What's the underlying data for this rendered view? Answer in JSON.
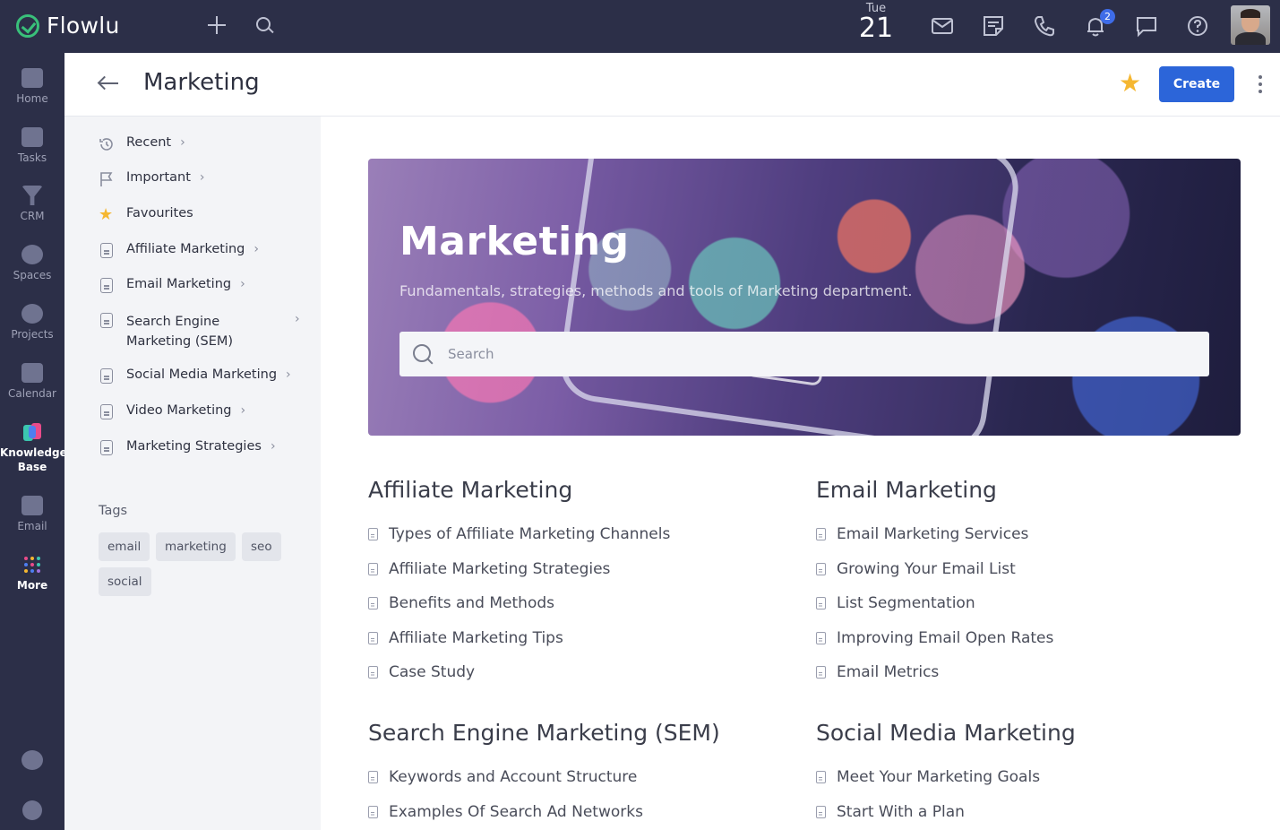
{
  "app": {
    "name": "Flowlu"
  },
  "topbar": {
    "date_dow": "Tue",
    "date_day": "21",
    "notification_count": "2",
    "icons": [
      "plus-icon",
      "search-icon",
      "mail-icon",
      "notes-icon",
      "phone-icon",
      "bell-icon",
      "chat-icon",
      "help-icon"
    ]
  },
  "rail": {
    "items": [
      {
        "label": "Home",
        "icon": "home-icon"
      },
      {
        "label": "Tasks",
        "icon": "tasks-icon"
      },
      {
        "label": "CRM",
        "icon": "crm-icon"
      },
      {
        "label": "Spaces",
        "icon": "spaces-icon"
      },
      {
        "label": "Projects",
        "icon": "projects-icon"
      },
      {
        "label": "Calendar",
        "icon": "calendar-icon"
      },
      {
        "label": "Knowledge Base",
        "icon": "knowledge-base-icon",
        "active": true
      },
      {
        "label": "Email",
        "icon": "email-icon"
      },
      {
        "label": "More",
        "icon": "more-icon"
      }
    ]
  },
  "header": {
    "title": "Marketing",
    "create_label": "Create"
  },
  "sidebar": {
    "items": [
      {
        "label": "Recent",
        "icon": "history-icon",
        "chevron": true
      },
      {
        "label": "Important",
        "icon": "flag-icon",
        "chevron": true
      },
      {
        "label": "Favourites",
        "icon": "star-icon",
        "chevron": false
      },
      {
        "label": "Affiliate Marketing",
        "icon": "document-icon",
        "chevron": true
      },
      {
        "label": "Email Marketing",
        "icon": "document-icon",
        "chevron": true
      },
      {
        "label": "Search Engine Marketing (SEM)",
        "label_line1": "Search Engine",
        "label_line2": "Marketing (SEM)",
        "icon": "document-icon",
        "chevron": true
      },
      {
        "label": "Social Media Marketing",
        "icon": "document-icon",
        "chevron": true
      },
      {
        "label": "Video Marketing",
        "icon": "document-icon",
        "chevron": true
      },
      {
        "label": "Marketing Strategies",
        "icon": "document-icon",
        "chevron": true
      }
    ],
    "tags_title": "Tags",
    "tags": [
      "email",
      "marketing",
      "seo",
      "social"
    ]
  },
  "hero": {
    "title": "Marketing",
    "subtitle": "Fundamentals, strategies, methods and tools of Marketing department.",
    "search_placeholder": "Search"
  },
  "sections": [
    {
      "title": "Affiliate Marketing",
      "articles": [
        "Types of Affiliate Marketing Channels",
        "Affiliate Marketing Strategies",
        "Benefits and Methods",
        "Affiliate Marketing Tips",
        "Case Study"
      ]
    },
    {
      "title": "Email Marketing",
      "articles": [
        "Email Marketing Services",
        "Growing Your Email List",
        "List Segmentation",
        "Improving Email Open Rates",
        "Email Metrics"
      ]
    },
    {
      "title": "Search Engine Marketing (SEM)",
      "articles": [
        "Keywords and Account Structure",
        "Examples Of Search Ad Networks"
      ]
    },
    {
      "title": "Social Media Marketing",
      "articles": [
        "Meet Your Marketing Goals",
        "Start With a Plan"
      ]
    }
  ],
  "colors": {
    "topbar_bg": "#2c2f48",
    "accent": "#2c65d9",
    "logo_green": "#39c07a",
    "star": "#f5b731"
  }
}
